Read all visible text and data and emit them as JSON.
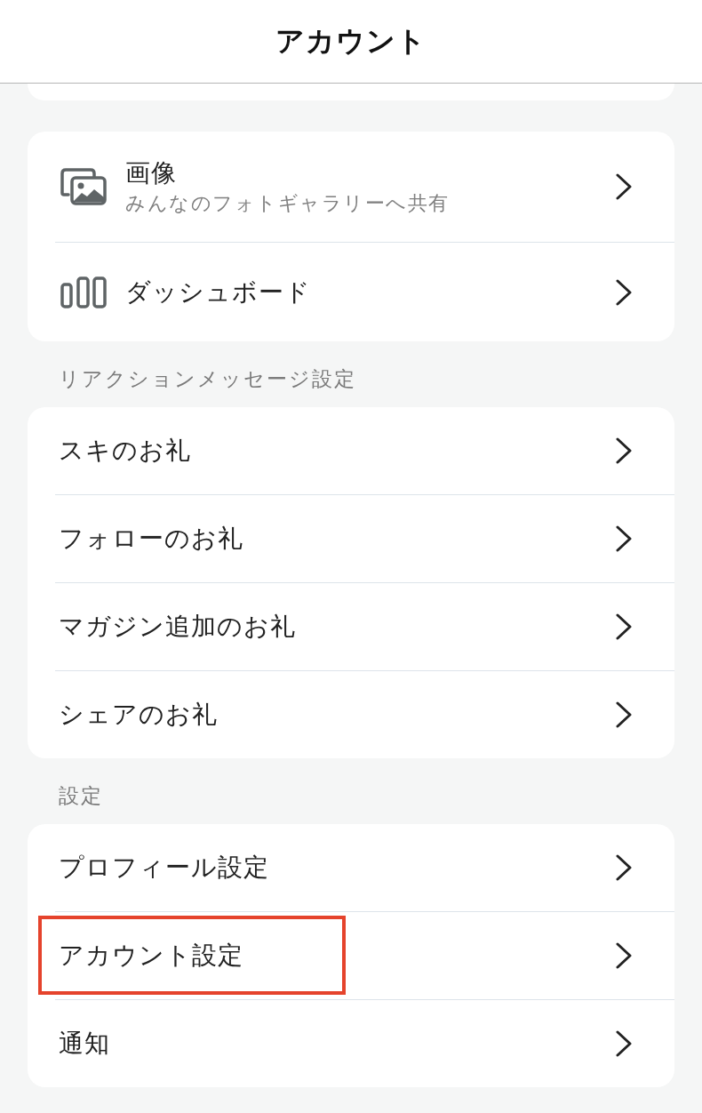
{
  "header": {
    "title": "アカウント"
  },
  "groups": [
    {
      "items": [
        {
          "kind": "gallery",
          "label": "画像",
          "subtitle": "みんなのフォトギャラリーへ共有",
          "highlighted": false
        },
        {
          "kind": "dashboard",
          "label": "ダッシュボード",
          "highlighted": false
        }
      ]
    },
    {
      "heading": "リアクションメッセージ設定",
      "items": [
        {
          "kind": "text",
          "label": "スキのお礼",
          "highlighted": false
        },
        {
          "kind": "text",
          "label": "フォローのお礼",
          "highlighted": false
        },
        {
          "kind": "text",
          "label": "マガジン追加のお礼",
          "highlighted": false
        },
        {
          "kind": "text",
          "label": "シェアのお礼",
          "highlighted": false
        }
      ]
    },
    {
      "heading": "設定",
      "items": [
        {
          "kind": "text",
          "label": "プロフィール設定",
          "highlighted": false
        },
        {
          "kind": "text",
          "label": "アカウント設定",
          "highlighted": true
        },
        {
          "kind": "text",
          "label": "通知",
          "highlighted": false
        }
      ]
    }
  ]
}
